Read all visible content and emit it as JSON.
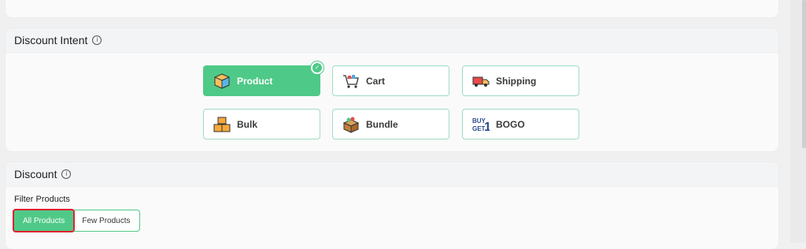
{
  "intent": {
    "title": "Discount Intent",
    "info_icon": "info-icon",
    "options": [
      {
        "label": "Product",
        "icon": "box-icon",
        "selected": true
      },
      {
        "label": "Cart",
        "icon": "cart-icon",
        "selected": false
      },
      {
        "label": "Shipping",
        "icon": "truck-icon",
        "selected": false
      },
      {
        "label": "Bulk",
        "icon": "boxes-icon",
        "selected": false
      },
      {
        "label": "Bundle",
        "icon": "bundle-icon",
        "selected": false
      },
      {
        "label": "BOGO",
        "icon": "bogo-icon",
        "selected": false
      }
    ]
  },
  "discount": {
    "title": "Discount",
    "info_icon": "info-icon",
    "filter_label": "Filter Products",
    "filter_options": [
      {
        "label": "All Products",
        "active": true
      },
      {
        "label": "Few Products",
        "active": false
      }
    ]
  },
  "colors": {
    "accent": "#4fc987",
    "highlight_border": "#e0202f"
  }
}
